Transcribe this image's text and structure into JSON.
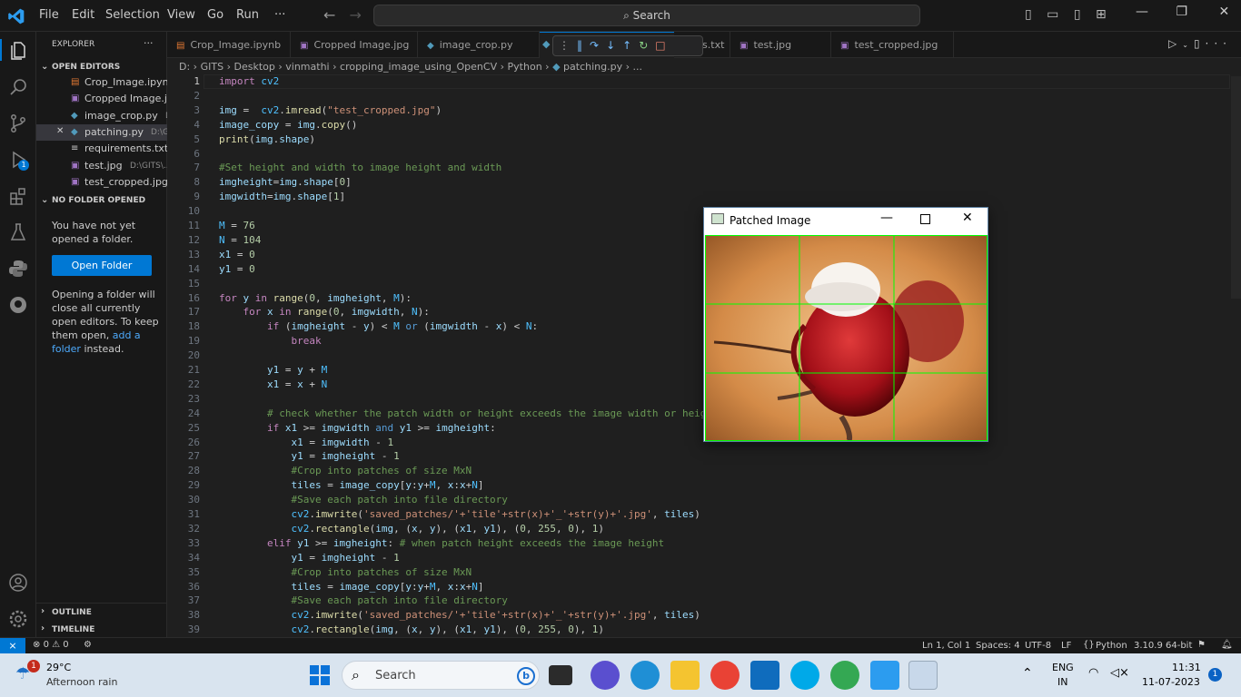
{
  "menu": {
    "file": "File",
    "edit": "Edit",
    "selection": "Selection",
    "view": "View",
    "go": "Go",
    "run": "Run",
    "more": "···"
  },
  "search": {
    "placeholder": "Search"
  },
  "explorer": {
    "title": "EXPLORER",
    "more": "···",
    "open_editors": "OPEN EDITORS",
    "no_folder": "NO FOLDER OPENED",
    "msg1": "You have not yet opened a folder.",
    "open_folder": "Open Folder",
    "msg2a": "Opening a folder will close all currently open editors. To keep them open,",
    "msg2link": "add a folder",
    "msg2b": "instead.",
    "outline": "OUTLINE",
    "timeline": "TIMELINE",
    "files": [
      {
        "name": "Crop_Image.ipyn...",
        "path": "",
        "icon": "notebook-icon",
        "color": "#e37933"
      },
      {
        "name": "Cropped Image.j...",
        "path": "",
        "icon": "image-icon",
        "color": "#a074c4"
      },
      {
        "name": "image_crop.py",
        "path": "D...",
        "icon": "python-icon",
        "color": "#519aba"
      },
      {
        "name": "patching.py",
        "path": "D:\\G...",
        "icon": "python-icon",
        "color": "#519aba"
      },
      {
        "name": "requirements.txt...",
        "path": "",
        "icon": "text-icon",
        "color": "#cccccc"
      },
      {
        "name": "test.jpg",
        "path": "D:\\GITS\\...",
        "icon": "image-icon",
        "color": "#a074c4"
      },
      {
        "name": "test_cropped.jpg...",
        "path": "",
        "icon": "image-icon",
        "color": "#a074c4"
      }
    ]
  },
  "tabs": [
    {
      "label": "Crop_Image.ipynb",
      "icon": "notebook-icon",
      "color": "#e37933"
    },
    {
      "label": "Cropped Image.jpg",
      "icon": "image-icon",
      "color": "#a074c4"
    },
    {
      "label": "image_crop.py",
      "icon": "python-icon",
      "color": "#519aba"
    },
    {
      "label": "nents.txt",
      "icon": "python-icon",
      "color": "#519aba"
    },
    {
      "label": "test.jpg",
      "icon": "image-icon",
      "color": "#a074c4"
    },
    {
      "label": "test_cropped.jpg",
      "icon": "image-icon",
      "color": "#a074c4"
    }
  ],
  "breadcrumb": [
    "D:",
    "GITS",
    "Desktop",
    "vinmathi",
    "cropping_image_using_OpenCV",
    "Python",
    "patching.py",
    "..."
  ],
  "code": {
    "l1": "import cv2",
    "l3a": "img",
    "l3b": "cv2.imread(",
    "l3c": "\"test_cropped.jpg\"",
    "l3d": ")",
    "comment7": "#Set height and width to image height and width",
    "comment24": "# check whether the patch width or height exceeds the image width or height",
    "comment28": "#Crop into patches of size MxN",
    "comment30": "#Save each patch into file directory",
    "comment33": "# when patch height exceeds the image height",
    "s31": "'saved_patches/'+'tile'+str(x)+'_'+str(y)+'.jpg'"
  },
  "popup": {
    "title": "Patched Image"
  },
  "status": {
    "errors": "0",
    "warnings": "0",
    "position": "Ln 1, Col 1",
    "spaces": "Spaces: 4",
    "encoding": "UTF-8",
    "eol": "LF",
    "language": "Python",
    "interpreter": "3.10.9 64-bit"
  },
  "taskbar": {
    "temp": "29°C",
    "weather": "Afternoon rain",
    "badge": "1",
    "search": "Search",
    "lang1": "ENG",
    "lang2": "IN",
    "time": "11:31",
    "date": "11-07-2023",
    "notif": "1"
  }
}
